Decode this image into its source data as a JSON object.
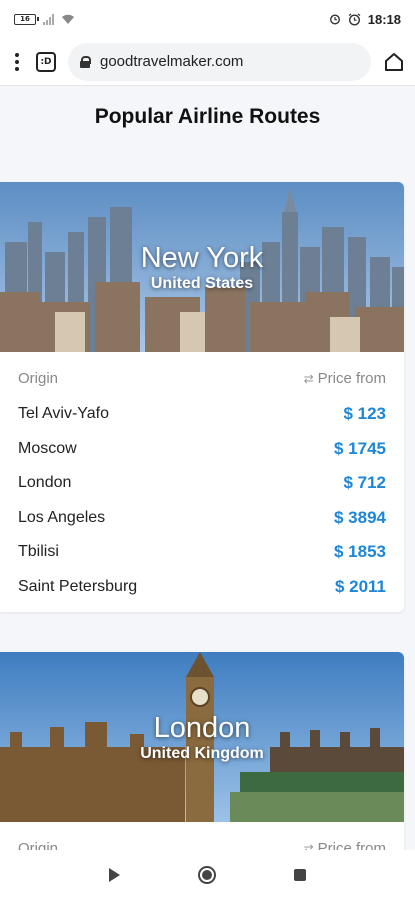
{
  "status": {
    "battery": "16",
    "time": "18:18"
  },
  "browser": {
    "url": "goodtravelmaker.com",
    "tab_count": ":D"
  },
  "page": {
    "title": "Popular Airline Routes"
  },
  "cards": [
    {
      "city": "New York",
      "country": "United States",
      "origin_label": "Origin",
      "price_label": "Price from",
      "routes": [
        {
          "origin": "Tel Aviv-Yafo",
          "price": "$ 123"
        },
        {
          "origin": "Moscow",
          "price": "$ 1745"
        },
        {
          "origin": "London",
          "price": "$ 712"
        },
        {
          "origin": "Los Angeles",
          "price": "$ 3894"
        },
        {
          "origin": "Tbilisi",
          "price": "$ 1853"
        },
        {
          "origin": "Saint Petersburg",
          "price": "$ 2011"
        }
      ]
    },
    {
      "city": "London",
      "country": "United Kingdom",
      "origin_label": "Origin",
      "price_label": "Price from"
    }
  ],
  "colors": {
    "price": "#1e86d6",
    "background": "#f4f6f9"
  }
}
